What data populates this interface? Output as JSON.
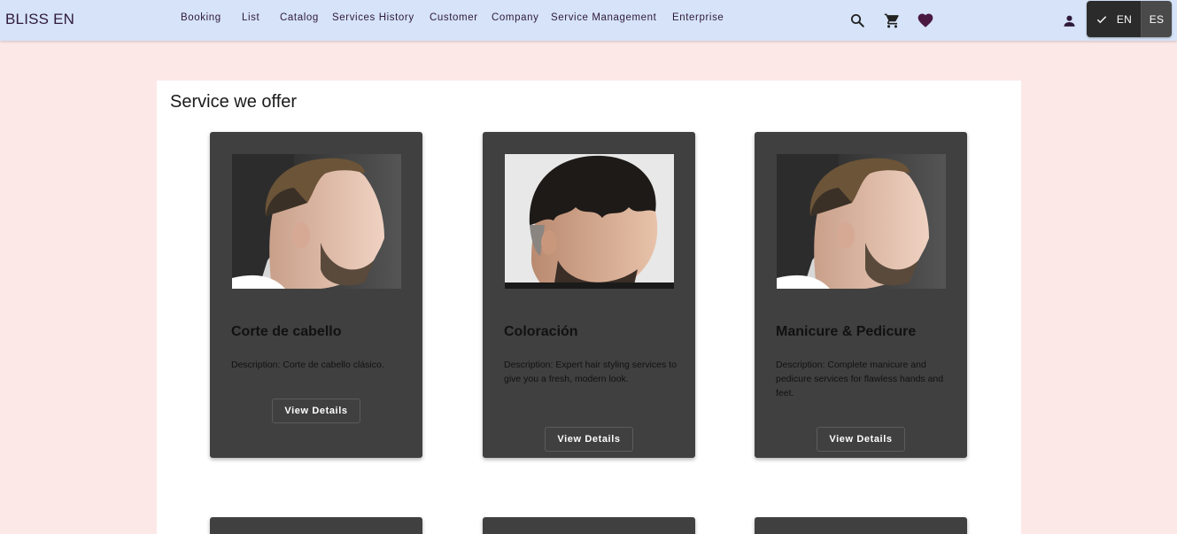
{
  "header": {
    "brand": "BLISS EN",
    "nav": [
      "Booking",
      "List",
      "Catalog",
      "Services History",
      "Customer",
      "Company",
      "Service Management",
      "Enterprise"
    ],
    "icons": [
      "search-icon",
      "cart-icon",
      "heart-icon",
      "account-icon"
    ],
    "languages": [
      {
        "code": "EN",
        "selected": true
      },
      {
        "code": "ES",
        "selected": false
      }
    ]
  },
  "main": {
    "title": "Service we offer",
    "cards": [
      {
        "title": "Corte de cabello",
        "description": "Description: Corte de cabello clásico.",
        "button": "View Details",
        "image": "fade-haircut-side-profile"
      },
      {
        "title": "Coloración",
        "description": "Description: Expert hair styling services to give you a fresh, modern look.",
        "button": "View Details",
        "image": "textured-crop-haircut"
      },
      {
        "title": "Manicure & Pedicure",
        "description": "Description: Complete manicure and pedicure services for flawless hands and feet.",
        "button": "View Details",
        "image": "fade-haircut-side-profile"
      }
    ]
  },
  "colors": {
    "header_bg": "#d6e3f8",
    "page_bg": "#fde8e8",
    "card_bg": "#404040",
    "brand_text": "#2f1a3a"
  }
}
